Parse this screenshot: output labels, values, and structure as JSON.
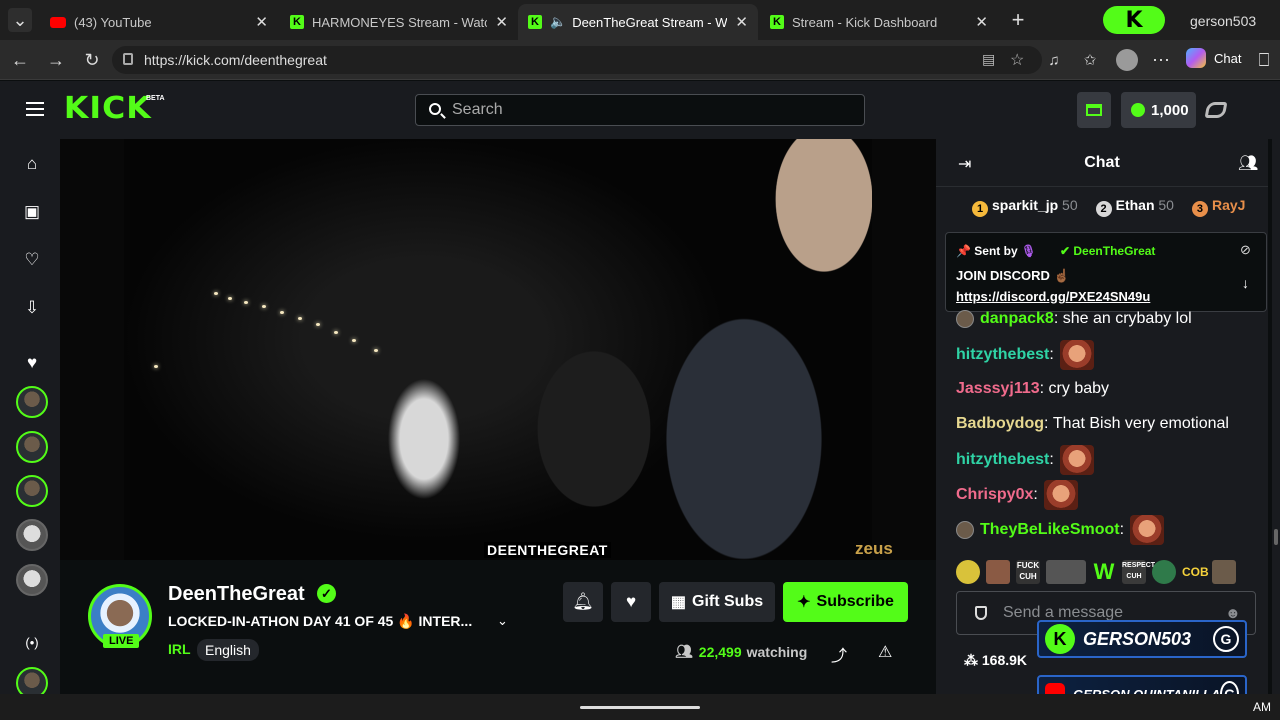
{
  "browser": {
    "tabs": [
      {
        "title": "(43) YouTube",
        "favicon": "youtube-icon"
      },
      {
        "title": "HARMONEYES Stream - Watch Live",
        "favicon": "kick-icon"
      },
      {
        "title": "DeenTheGreat Stream - Watch",
        "favicon": "kick-icon",
        "audio": "speaker-icon"
      },
      {
        "title": "Stream - Kick Dashboard",
        "favicon": "kick-icon"
      }
    ],
    "profile_name": "gerson503",
    "url": "https://kick.com/deenthegreat",
    "chat_label": "Chat"
  },
  "site": {
    "logo": "KICK",
    "logo_badge": "BETA",
    "search_placeholder": "Search",
    "points": "1,000"
  },
  "video": {
    "watermark_left": "DEENTHEGREAT",
    "watermark_right": "zeus"
  },
  "stream": {
    "channel": "DeenTheGreat",
    "live_badge": "LIVE",
    "title": "LOCKED-IN-ATHON DAY 41 OF 45 🔥 INTER...",
    "category": "IRL",
    "language": "English",
    "gift_label": "Gift Subs",
    "subscribe_label": "Subscribe",
    "viewers": "22,499",
    "watching_label": "watching"
  },
  "chat": {
    "header": "Chat",
    "leaderboard": [
      {
        "rank": "1",
        "name": "sparkit_jp",
        "points": "50"
      },
      {
        "rank": "2",
        "name": "Ethan",
        "points": "50"
      },
      {
        "rank": "3",
        "name": "RayJ",
        "points": ""
      }
    ],
    "pinned": {
      "sent_by": "Sent by",
      "author": "DeenTheGreat",
      "message": "JOIN DISCORD ☝🏾",
      "link": "https://discord.gg/PXE24SN49u"
    },
    "messages": [
      {
        "user": "danpack8",
        "text": "she an crybaby lol",
        "color": "#53fc18",
        "badge": true
      },
      {
        "user": "hitzythebest",
        "text": "",
        "color": "#2fd3a5",
        "emote": true
      },
      {
        "user": "Jasssyj113",
        "text": "cry baby",
        "color": "#f06b8c"
      },
      {
        "user": "Badboydog",
        "text": "That Bish very emotional",
        "color": "#e6d890"
      },
      {
        "user": "hitzythebest",
        "text": "",
        "color": "#2fd3a5",
        "emote": true
      },
      {
        "user": "Chrispy0x",
        "text": "",
        "color": "#f06b8c",
        "emote": true
      },
      {
        "user": "TheyBeLikeSmoot",
        "text": "",
        "color": "#53fc18",
        "badge": true,
        "emote": true
      }
    ],
    "emote_row": [
      "",
      "",
      "FUCK CUH",
      "",
      "W",
      "RESPECT CUH",
      "",
      "COB",
      ""
    ],
    "input_placeholder": "Send a message",
    "followers": "168.9K"
  },
  "overlay": {
    "kick_name": "GERSON503",
    "youtube_name": "GERSON QUINTANILLA",
    "brand_letter": "G"
  },
  "taskbar": {
    "time_suffix": "AM"
  },
  "colors": {
    "accent": "#53fc18",
    "background": "#0b0e0f",
    "panel": "#191b1f"
  }
}
